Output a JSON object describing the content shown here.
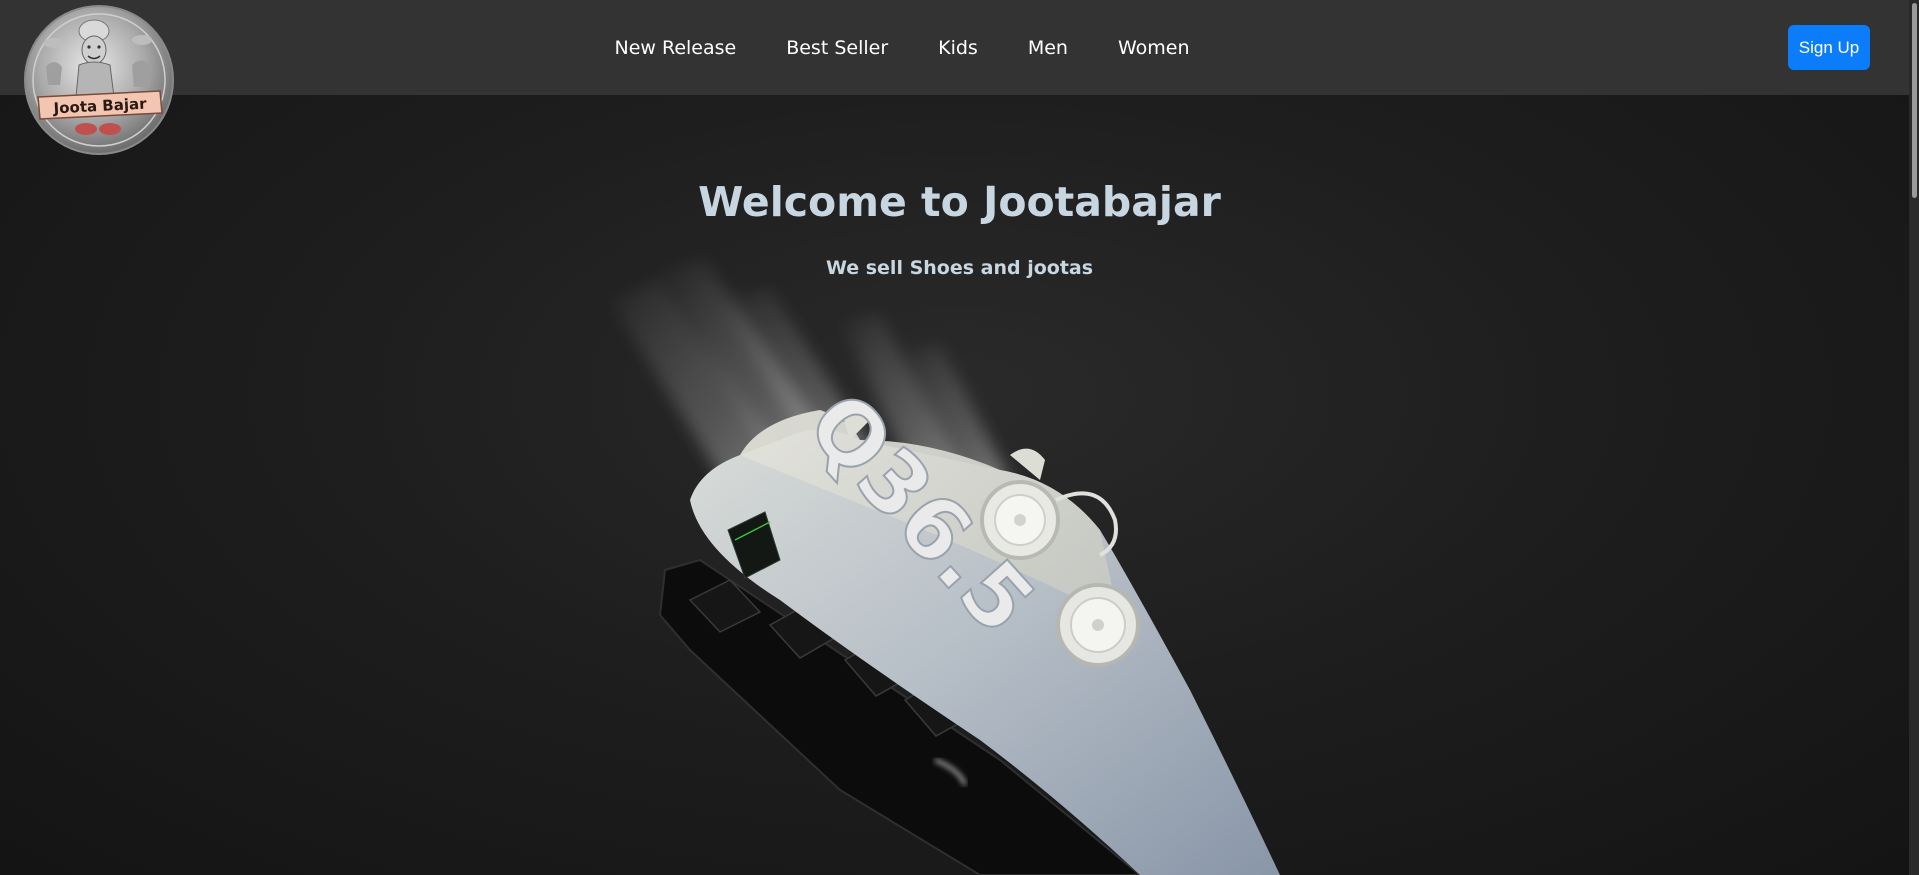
{
  "brand": {
    "logo_text": "Joota Bajar",
    "logo_icon": "cartoon-mascot-badge-logo"
  },
  "nav": {
    "links": [
      {
        "label": "New Release"
      },
      {
        "label": "Best Seller"
      },
      {
        "label": "Kids"
      },
      {
        "label": "Men"
      },
      {
        "label": "Women"
      }
    ],
    "signup_label": "Sign Up"
  },
  "hero": {
    "title": "Welcome to Jootabajar",
    "subtitle": "We sell Shoes and jootas",
    "image_icon": "cycling-shoe-hero-image",
    "shoe_print": "Q36.5"
  },
  "colors": {
    "navbar_bg": "#333333",
    "page_bg": "#1c1c1c",
    "accent": "#0b7dfa",
    "heading_text": "#c7d6e0",
    "nav_text": "#ffffff"
  }
}
